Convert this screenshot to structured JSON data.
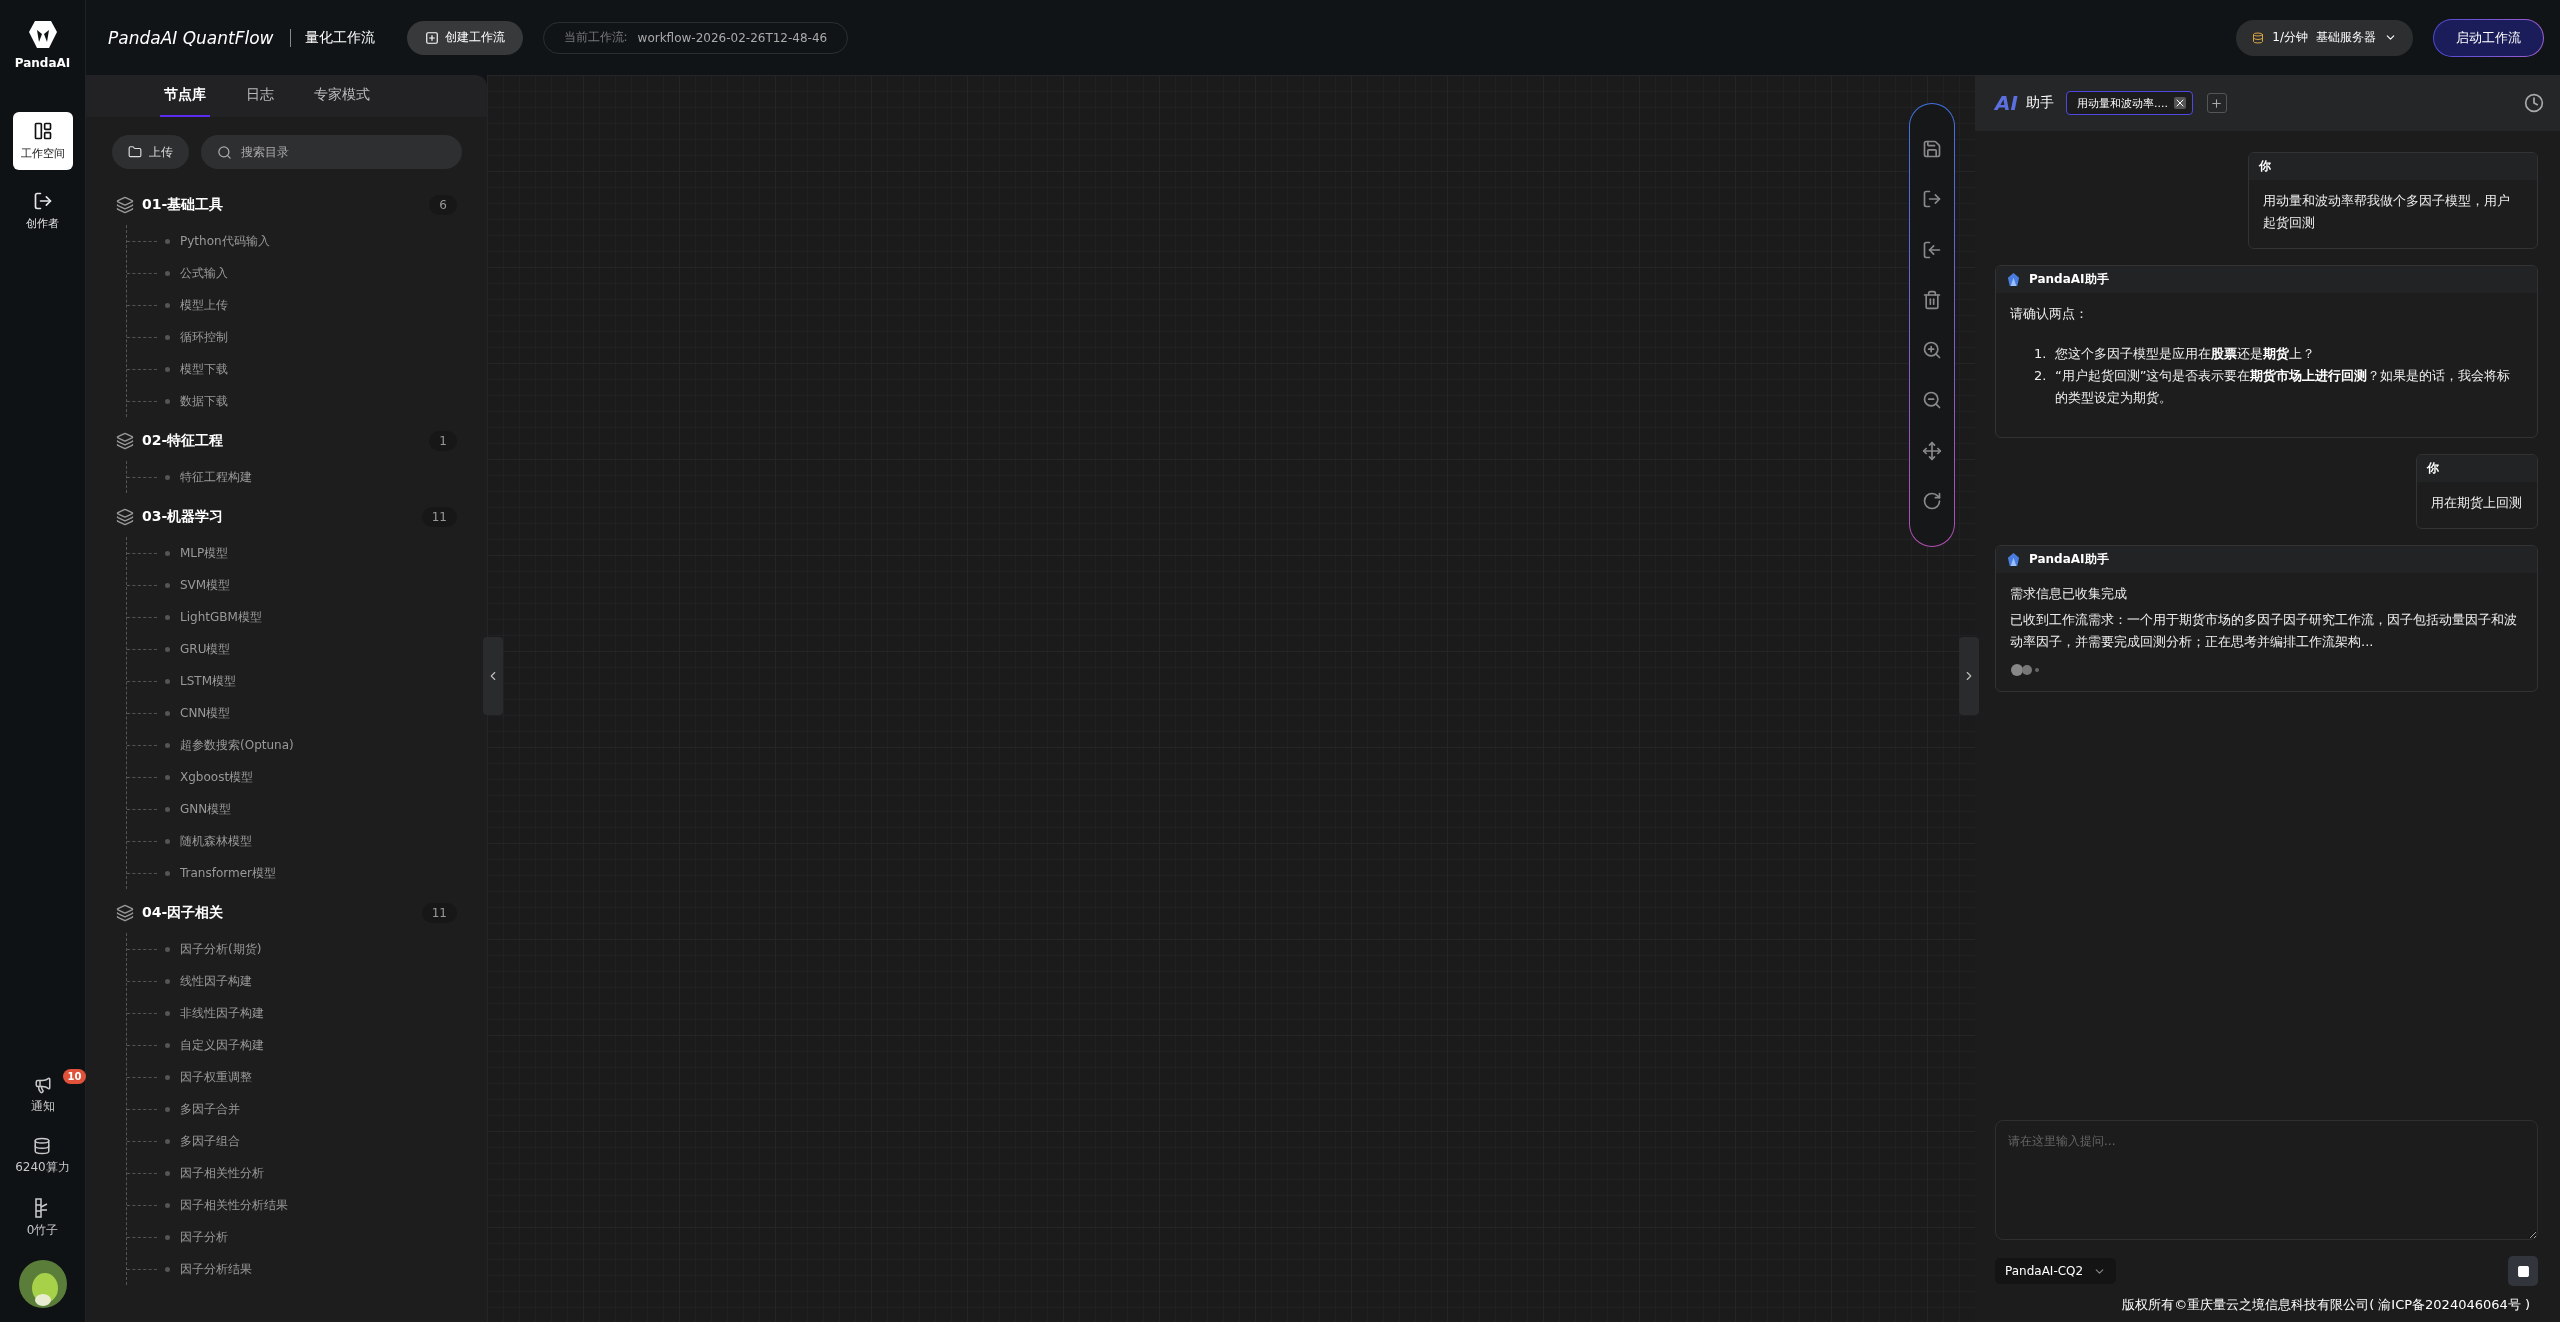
{
  "sidebar": {
    "logo": "PandaAI",
    "items": [
      {
        "kind": "workspace",
        "label": "工作空间",
        "selected": true
      },
      {
        "kind": "creator",
        "label": "创作者",
        "selected": false
      }
    ],
    "bottom": [
      {
        "kind": "notice",
        "label": "通知",
        "badge": "10"
      },
      {
        "kind": "compute",
        "label": "6240算力"
      },
      {
        "kind": "bamboo",
        "label": "0竹子"
      }
    ]
  },
  "header": {
    "brand": "PandaAI QuantFlow",
    "subtitle": "量化工作流",
    "create_button": "创建工作流",
    "current_label": "当前工作流:",
    "current_value": "workflow-2026-02-26T12-48-46",
    "rate": "1/分钟",
    "server": "基础服务器",
    "start_button": "启动工作流"
  },
  "node_panel": {
    "tabs": [
      {
        "label": "节点库",
        "selected": true
      },
      {
        "label": "日志",
        "selected": false
      },
      {
        "label": "专家模式",
        "selected": false
      }
    ],
    "upload_button": "上传",
    "search": {
      "placeholder": "搜索目录"
    },
    "groups": [
      {
        "title": "01-基础工具",
        "count": "6",
        "children": [
          {
            "label": "Python代码输入"
          },
          {
            "label": "公式输入"
          },
          {
            "label": "模型上传"
          },
          {
            "label": "循环控制"
          },
          {
            "label": "模型下载"
          },
          {
            "label": "数据下载"
          }
        ]
      },
      {
        "title": "02-特征工程",
        "count": "1",
        "children": [
          {
            "label": "特征工程构建"
          }
        ]
      },
      {
        "title": "03-机器学习",
        "count": "11",
        "children": [
          {
            "label": "MLP模型"
          },
          {
            "label": "SVM模型"
          },
          {
            "label": "LightGBM模型"
          },
          {
            "label": "GRU模型"
          },
          {
            "label": "LSTM模型"
          },
          {
            "label": "CNN模型"
          },
          {
            "label": "超参数搜索(Optuna)"
          },
          {
            "label": "Xgboost模型"
          },
          {
            "label": "GNN模型"
          },
          {
            "label": "随机森林模型"
          },
          {
            "label": "Transformer模型"
          }
        ]
      },
      {
        "title": "04-因子相关",
        "count": "11",
        "children": [
          {
            "label": "因子分析(期货)"
          },
          {
            "label": "线性因子构建"
          },
          {
            "label": "非线性因子构建"
          },
          {
            "label": "自定义因子构建"
          },
          {
            "label": "因子权重调整"
          },
          {
            "label": "多因子合并"
          },
          {
            "label": "多因子组合"
          },
          {
            "label": "因子相关性分析"
          },
          {
            "label": "因子相关性分析结果"
          },
          {
            "label": "因子分析"
          },
          {
            "label": "因子分析结果"
          }
        ]
      }
    ]
  },
  "assistant": {
    "logo": "AI",
    "title": "助手",
    "session_tab": {
      "label": "用动量和波动率....",
      "selected": true
    },
    "messages": [
      {
        "kind": "user",
        "author": "你",
        "blocks": [
          {
            "kind": "paragraph",
            "text": "用动量和波动率帮我做个多因子模型，用户起货回测"
          }
        ]
      },
      {
        "kind": "assistant",
        "author": "PandaAI助手",
        "blocks": [
          {
            "kind": "paragraph",
            "text": "请确认两点："
          },
          {
            "kind": "list",
            "items": [
              {
                "marker": "1.",
                "text": "您这个多因子模型是应用在**股票**还是**期货**上？"
              },
              {
                "marker": "2.",
                "text": "“用户起货回测”这句是否表示要在**期货市场上进行回测**？如果是的话，我会将标的类型设定为期货。"
              }
            ]
          }
        ]
      },
      {
        "kind": "user",
        "author": "你",
        "blocks": [
          {
            "kind": "paragraph",
            "text": "用在期货上回测"
          }
        ]
      },
      {
        "kind": "assistant",
        "author": "PandaAI助手",
        "typing": true,
        "blocks": [
          {
            "kind": "paragraph",
            "text": "需求信息已收集完成"
          },
          {
            "kind": "paragraph",
            "text": "已收到工作流需求：一个用于期货市场的多因子因子研究工作流，因子包括动量因子和波动率因子，并需要完成回测分析；正在思考并编排工作流架构..."
          }
        ]
      }
    ],
    "input": {
      "placeholder": "请在这里输入提问..."
    },
    "model": "PandaAI-CQ2",
    "footer": "版权所有©重庆量云之境信息科技有限公司( 渝ICP备2024046064号 )"
  }
}
